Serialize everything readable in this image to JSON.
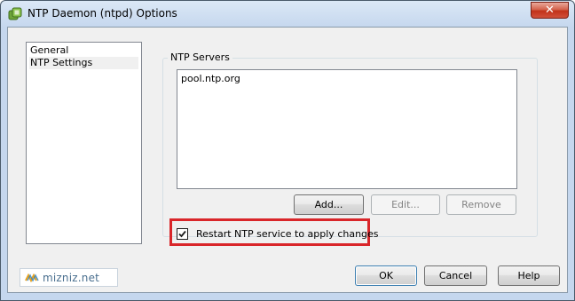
{
  "window": {
    "title": "NTP Daemon (ntpd) Options",
    "close_glyph": "✕",
    "icon": "vsphere-app-icon"
  },
  "nav": {
    "items": [
      {
        "label": "General",
        "selected": false
      },
      {
        "label": "NTP Settings",
        "selected": true
      }
    ]
  },
  "servers": {
    "group_label": "NTP Servers",
    "items": [
      "pool.ntp.org"
    ],
    "add_label": "Add...",
    "edit_label": "Edit...",
    "remove_label": "Remove"
  },
  "restart": {
    "label": "Restart NTP service to apply changes",
    "checked": true
  },
  "footer": {
    "logo_text": "mizniz.net",
    "ok_label": "OK",
    "cancel_label": "Cancel",
    "help_label": "Help"
  },
  "colors": {
    "highlight": "#d9262a",
    "close_button": "#c2321a",
    "logo_text": "#4a6f8f"
  }
}
